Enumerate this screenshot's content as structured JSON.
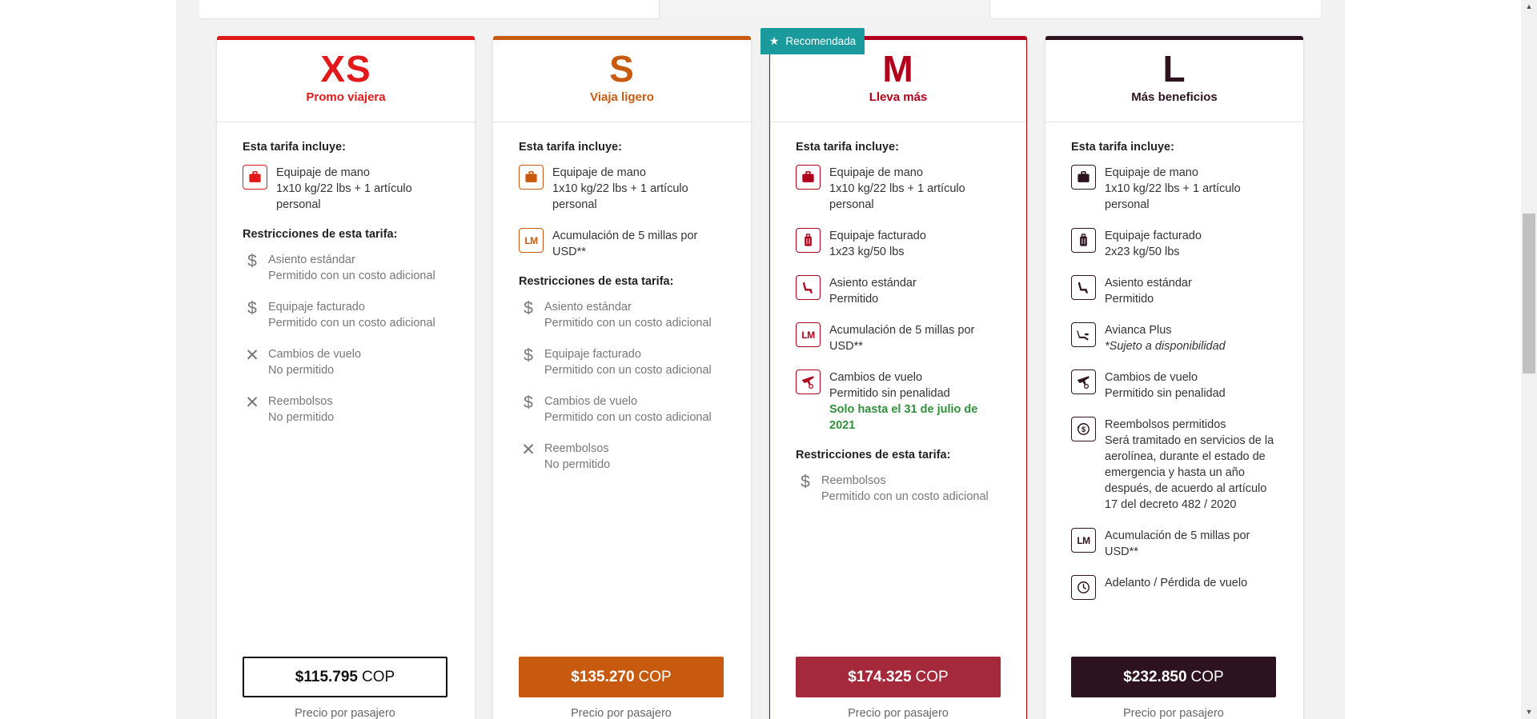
{
  "badge": {
    "star_icon": "star-icon",
    "label": "Recomendada"
  },
  "cards": [
    {
      "code": "XS",
      "subtitle": "Promo viajera",
      "color": "#e1191b",
      "includes_title": "Esta tarifa incluye:",
      "includes": [
        {
          "icon": "briefcase-icon",
          "title": "Equipaje de mano",
          "desc": "1x10 kg/22 lbs + 1 artículo personal"
        }
      ],
      "restrictions_title": "Restricciones de esta tarifa:",
      "restrictions": [
        {
          "icon": "dollar-icon",
          "symbol": "$",
          "title": "Asiento estándar",
          "desc": "Permitido con un costo adicional"
        },
        {
          "icon": "dollar-icon",
          "symbol": "$",
          "title": "Equipaje facturado",
          "desc": "Permitido con un costo adicional"
        },
        {
          "icon": "close-icon",
          "symbol": "✕",
          "title": "Cambios de vuelo",
          "desc": "No permitido"
        },
        {
          "icon": "close-icon",
          "symbol": "✕",
          "title": "Reembolsos",
          "desc": "No permitido"
        }
      ],
      "price": "$115.795",
      "currency": "COP",
      "per_passenger": "Precio por pasajero",
      "button_style": "outline"
    },
    {
      "code": "S",
      "subtitle": "Viaja ligero",
      "color": "#c85a0f",
      "includes_title": "Esta tarifa incluye:",
      "includes": [
        {
          "icon": "briefcase-icon",
          "title": "Equipaje de mano",
          "desc": "1x10 kg/22 lbs + 1 artículo personal"
        },
        {
          "icon": "lifemiles-icon",
          "lm": "LM",
          "title": "Acumulación de 5 millas por USD**",
          "desc": ""
        }
      ],
      "restrictions_title": "Restricciones de esta tarifa:",
      "restrictions": [
        {
          "icon": "dollar-icon",
          "symbol": "$",
          "title": "Asiento estándar",
          "desc": "Permitido con un costo adicional"
        },
        {
          "icon": "dollar-icon",
          "symbol": "$",
          "title": "Equipaje facturado",
          "desc": "Permitido con un costo adicional"
        },
        {
          "icon": "dollar-icon",
          "symbol": "$",
          "title": "Cambios de vuelo",
          "desc": "Permitido con un costo adicional"
        },
        {
          "icon": "close-icon",
          "symbol": "✕",
          "title": "Reembolsos",
          "desc": "No permitido"
        }
      ],
      "price": "$135.270",
      "currency": "COP",
      "per_passenger": "Precio por pasajero",
      "button_style": "solid"
    },
    {
      "code": "M",
      "subtitle": "Lleva más",
      "color": "#b1001b",
      "button_color": "#a3293b",
      "includes_title": "Esta tarifa incluye:",
      "includes": [
        {
          "icon": "briefcase-icon",
          "title": "Equipaje de mano",
          "desc": "1x10 kg/22 lbs + 1 artículo personal"
        },
        {
          "icon": "suitcase-icon",
          "title": "Equipaje facturado",
          "desc": "1x23 kg/50 lbs"
        },
        {
          "icon": "seat-icon",
          "title": "Asiento estándar",
          "desc": "Permitido"
        },
        {
          "icon": "lifemiles-icon",
          "lm": "LM",
          "title": "Acumulación de 5 millas por USD**",
          "desc": ""
        },
        {
          "icon": "flight-change-icon",
          "title": "Cambios de vuelo",
          "desc": "Permitido sin penalidad",
          "promo": "Solo hasta el 31 de julio de 2021"
        }
      ],
      "restrictions_title": "Restricciones de esta tarifa:",
      "restrictions": [
        {
          "icon": "dollar-icon",
          "symbol": "$",
          "title": "Reembolsos",
          "desc": "Permitido con un costo adicional"
        }
      ],
      "price": "$174.325",
      "currency": "COP",
      "per_passenger": "Precio por pasajero",
      "button_style": "solid"
    },
    {
      "code": "L",
      "subtitle": "Más beneficios",
      "color": "#2d1320",
      "includes_title": "Esta tarifa incluye:",
      "includes": [
        {
          "icon": "briefcase-icon",
          "title": "Equipaje de mano",
          "desc": "1x10 kg/22 lbs + 1 artículo personal"
        },
        {
          "icon": "suitcase-icon",
          "title": "Equipaje facturado",
          "desc": "2x23 kg/50 lbs"
        },
        {
          "icon": "seat-icon",
          "title": "Asiento estándar",
          "desc": "Permitido"
        },
        {
          "icon": "recline-seat-icon",
          "title": "Avianca Plus",
          "note": "*Sujeto a disponibilidad"
        },
        {
          "icon": "flight-change-icon",
          "title": "Cambios de vuelo",
          "desc": "Permitido sin penalidad"
        },
        {
          "icon": "refund-icon",
          "title": "Reembolsos permitidos",
          "desc": "Será tramitado en servicios de la aerolínea, durante el estado de emergencia y hasta un año después, de acuerdo al artículo 17 del decreto 482 / 2020"
        },
        {
          "icon": "lifemiles-icon",
          "lm": "LM",
          "title": "Acumulación de 5 millas por USD**",
          "desc": ""
        },
        {
          "icon": "clock-icon",
          "title": "Adelanto / Pérdida de vuelo",
          "desc": ""
        }
      ],
      "restrictions_title": "",
      "restrictions": [],
      "price": "$232.850",
      "currency": "COP",
      "per_passenger": "Precio por pasajero",
      "button_style": "solid"
    }
  ]
}
